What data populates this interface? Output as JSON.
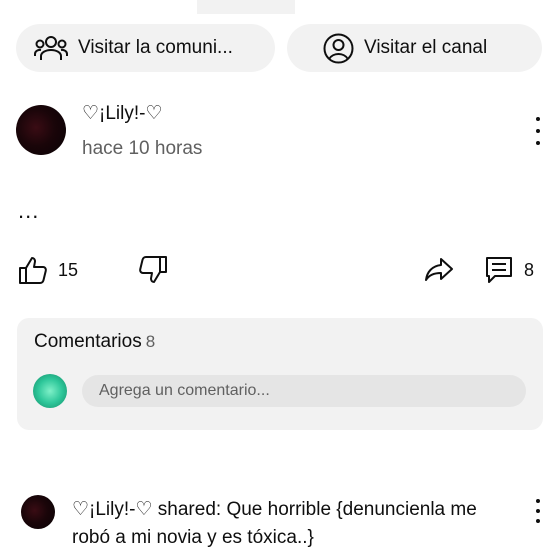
{
  "buttons": {
    "community": "Visitar la comuni...",
    "channel": "Visitar el canal"
  },
  "post": {
    "author": "♡¡Lily!-♡",
    "time": "hace 10 horas",
    "body": "...",
    "likes": "15",
    "comments_count": "8"
  },
  "comments": {
    "title": "Comentarios",
    "count": "8",
    "placeholder": "Agrega un comentario..."
  },
  "top_comment": {
    "author": "♡¡Lily!-♡",
    "action": "shared:",
    "text": "Que horrible {denuncienla me robó a mi novia y es tóxica..}"
  },
  "icons": {
    "community": "people-icon",
    "channel": "account-icon",
    "like": "thumb-up-icon",
    "dislike": "thumb-down-icon",
    "share": "share-icon",
    "comment": "comment-icon",
    "more": "more-vert-icon"
  },
  "colors": {
    "pill_bg": "#f2f2f2",
    "secondary_text": "#606060"
  }
}
